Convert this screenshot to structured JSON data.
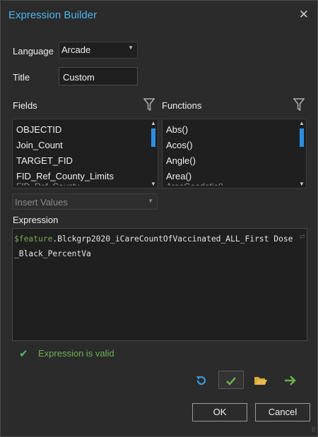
{
  "dialog": {
    "title": "Expression Builder",
    "close_glyph": "✕"
  },
  "language": {
    "label": "Language",
    "selected": "Arcade",
    "options_visible": [
      "Arcade"
    ]
  },
  "title_field": {
    "label": "Title",
    "value": "Custom"
  },
  "fields": {
    "label": "Fields",
    "filter_icon": "filter-icon",
    "items": [
      "OBJECTID",
      "Join_Count",
      "TARGET_FID",
      "FID_Ref_County_Limits"
    ]
  },
  "functions": {
    "label": "Functions",
    "filter_icon": "filter-icon",
    "items": [
      "Abs()",
      "Acos()",
      "Angle()",
      "Area()"
    ]
  },
  "insert_values": {
    "placeholder": "Insert Values"
  },
  "expression": {
    "label": "Expression",
    "prefix": "$feature",
    "rest": ".Blckgrp2020_iCareCountOfVaccinated_ALL_First Dose_Black_PercentVa"
  },
  "validation": {
    "text": "Expression is valid",
    "status_color": "#5cb85c"
  },
  "toolbar": {
    "icons": [
      "undo-icon",
      "verify-check-icon",
      "open-folder-icon",
      "run-arrow-icon"
    ]
  },
  "buttons": {
    "ok": "OK",
    "cancel": "Cancel"
  },
  "colors": {
    "accent": "#4db5f0",
    "keyword": "#7aa853",
    "scroll_thumb": "#2b8fe0"
  }
}
